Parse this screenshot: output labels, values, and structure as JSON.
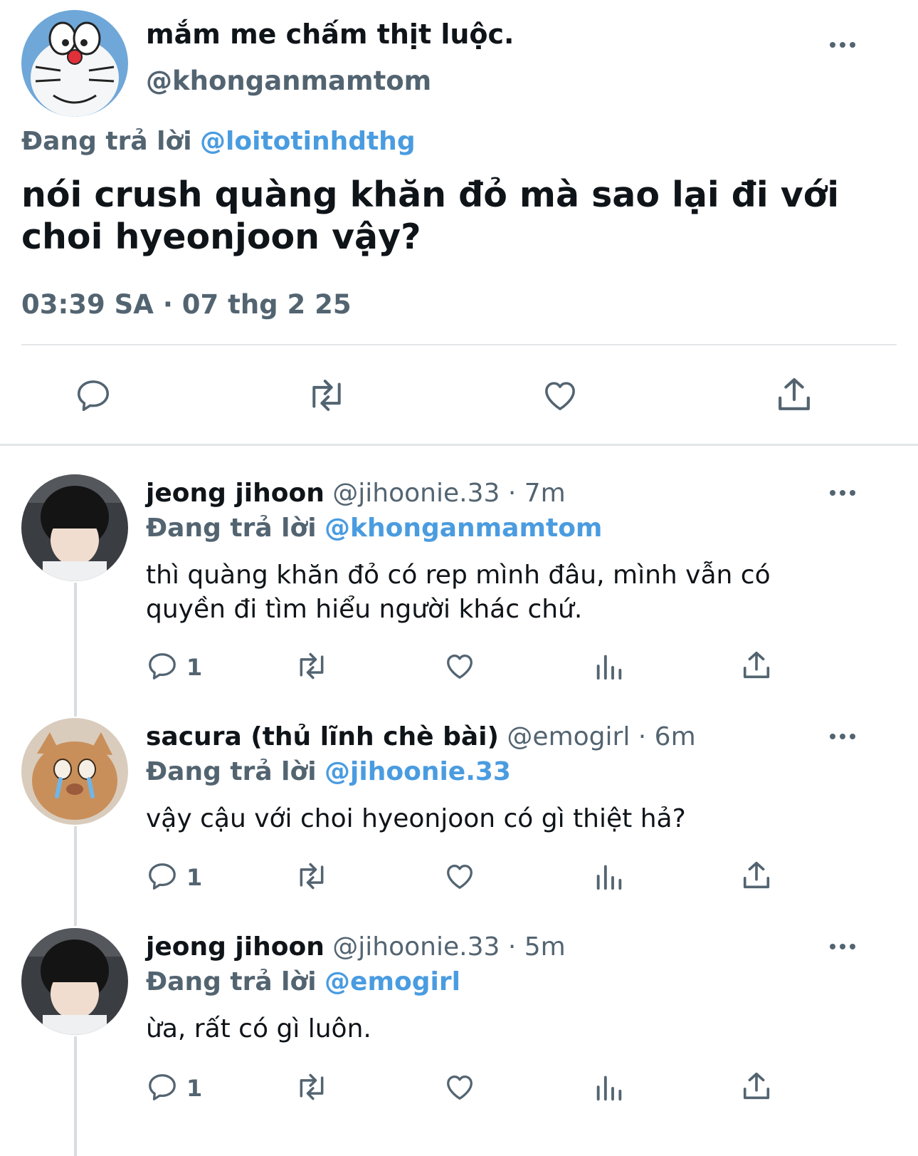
{
  "main_tweet": {
    "display_name": "mắm me chấm thịt luộc.",
    "handle": "@khonganmamtom",
    "reply_prefix": "Đang trả lời",
    "reply_to": "@loitotinhdthg",
    "text": "nói crush quàng khăn đỏ mà sao lại đi với choi hyeonjoon vậy?",
    "timestamp": "03:39 SA · 07 thg 2 25"
  },
  "replies": [
    {
      "display_name": "jeong jihoon",
      "handle": "@jihoonie.33",
      "time": "· 7m",
      "reply_prefix": "Đang trả lời",
      "reply_to": "@khonganmamtom",
      "text": "thì quàng khăn đỏ có rep mình đâu, mình vẫn có quyền đi tìm hiểu người khác chứ.",
      "reply_count": "1"
    },
    {
      "display_name": "sacura (thủ lĩnh chè bài)",
      "handle": "@emogirl",
      "time": "· 6m",
      "reply_prefix": "Đang trả lời",
      "reply_to": "@jihoonie.33",
      "text": "vậy cậu với choi hyeonjoon có gì thiệt hả?",
      "reply_count": "1"
    },
    {
      "display_name": "jeong jihoon",
      "handle": "@jihoonie.33",
      "time": "· 5m",
      "reply_prefix": "Đang trả lời",
      "reply_to": "@emogirl",
      "text": "ừa, rất có gì luôn.",
      "reply_count": "1"
    }
  ],
  "colors": {
    "link": "#4a9ce0",
    "muted": "#536471",
    "divider": "#e4e6e8"
  },
  "icons": [
    "more-icon",
    "reply-icon",
    "retweet-icon",
    "like-icon",
    "share-icon",
    "views-icon"
  ]
}
